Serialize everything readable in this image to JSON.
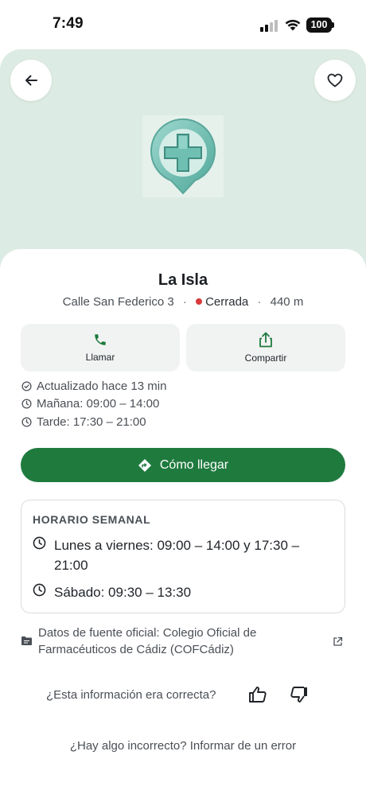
{
  "status_bar": {
    "time": "7:49",
    "battery": "100"
  },
  "header": {
    "back_icon": "arrow-left-icon",
    "favorite_icon": "heart-outline-icon",
    "logo_icon": "pharmacy-cross-pin-icon"
  },
  "pharmacy": {
    "name": "La Isla",
    "address": "Calle San Federico 3",
    "status": "Cerrada",
    "distance": "440 m",
    "status_color": "#d93a3a"
  },
  "actions": {
    "call_label": "Llamar",
    "share_label": "Compartir",
    "call_icon": "phone-icon",
    "share_icon": "share-icon"
  },
  "info": {
    "updated": "Actualizado hace 13 min",
    "morning": "Mañana: 09:00 – 14:00",
    "afternoon": "Tarde: 17:30 – 21:00"
  },
  "directions": {
    "label": "Cómo llegar",
    "icon": "directions-icon",
    "color": "#1f7a3e"
  },
  "weekly": {
    "title": "HORARIO SEMANAL",
    "rows": [
      {
        "text": "Lunes a viernes: 09:00 – 14:00 y 17:30 – 21:00"
      },
      {
        "text": "Sábado: 09:30 – 13:30"
      }
    ]
  },
  "source": {
    "text": "Datos de fuente oficial: Colegio Oficial de Farmacéuticos de Cádiz (COFCádiz)",
    "icon": "folder-icon",
    "link_icon": "external-link-icon"
  },
  "feedback": {
    "question": "¿Esta información era correcta?"
  },
  "report": {
    "text": "¿Hay algo incorrecto? Informar de un error"
  }
}
